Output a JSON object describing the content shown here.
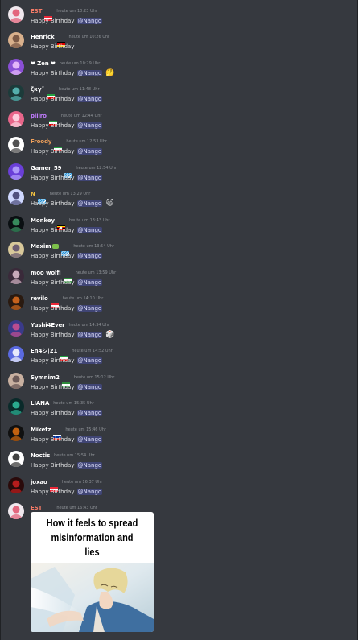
{
  "messages": [
    {
      "user": "EST",
      "name_color": "#f47b67",
      "flag": "austria",
      "time": "heute um 10:23 Uhr",
      "text": "Happy Birthday",
      "mention": "@Nango",
      "avatar": {
        "bg": "#f0e8ee",
        "fg": "#e0506a"
      }
    },
    {
      "user": "Henrick",
      "name_color": "#ffffff",
      "flag": "germany",
      "time": "heute um 10:26 Uhr",
      "text": "Happy Birthday",
      "mention": "",
      "avatar": {
        "bg": "#d9b08c",
        "fg": "#6b4a3a"
      }
    },
    {
      "user": "❤ Zen ❤",
      "name_color": "#ffffff",
      "flag": "",
      "time": "heute um 10:29 Uhr",
      "text": "Happy Birthday",
      "mention": "@Nango",
      "reaction": "🤔",
      "avatar": {
        "bg": "#8a4fd6",
        "fg": "#f2c7ff"
      }
    },
    {
      "user": "ζκγ˜",
      "name_color": "#ffffff",
      "flag": "iran",
      "time": "heute um 11:48 Uhr",
      "text": "Happy Birthday",
      "mention": "@Nango",
      "avatar": {
        "bg": "#1c3b3a",
        "fg": "#5ec3c0"
      }
    },
    {
      "user": "piiiro",
      "name_color": "#c27cff",
      "flag": "iran",
      "time": "heute um 12:44 Uhr",
      "text": "Happy Birthday",
      "mention": "@Nango",
      "avatar": {
        "bg": "#e8668a",
        "fg": "#ffe0ea"
      }
    },
    {
      "user": "Froody",
      "name_color": "#f0a05a",
      "flag": "iran",
      "time": "heute um 12:53 Uhr",
      "text": "Happy Birthday",
      "mention": "@Nango",
      "avatar": {
        "bg": "#ffffff",
        "fg": "#333333"
      }
    },
    {
      "user": "Gamer_59",
      "name_color": "#ffffff",
      "flag": "bavaria",
      "time": "heute um 12:54 Uhr",
      "text": "Happy Birthday",
      "mention": "@Nango",
      "avatar": {
        "bg": "#6a3fd8",
        "fg": "#b8a8ff"
      }
    },
    {
      "user": "N",
      "name_color": "#f0c040",
      "flag": "bavaria",
      "time": "heute um 13:29 Uhr",
      "text": "Happy Birthday",
      "mention": "@Nango",
      "reaction": "😸",
      "avatar": {
        "bg": "#cfd8ff",
        "fg": "#3a3a6a"
      }
    },
    {
      "user": "Monkey",
      "name_color": "#ffffff",
      "flag": "uganda",
      "time": "heute um 13:43 Uhr",
      "text": "Happy Birthday",
      "mention": "@Nango",
      "avatar": {
        "bg": "#0a0f12",
        "fg": "#3fa06a"
      }
    },
    {
      "user": "Maxim",
      "name_color": "#ffffff",
      "flag": "bavaria",
      "time": "heute um 13:54 Uhr",
      "text": "Happy Birthday",
      "mention": "@Nango",
      "avatar": {
        "bg": "#d8c89a",
        "fg": "#5a4a6a"
      }
    },
    {
      "user": "moo wolfi",
      "name_color": "#ffffff",
      "flag": "green",
      "time": "heute um 13:59 Uhr",
      "text": "Happy Birthday",
      "mention": "@Nango",
      "avatar": {
        "bg": "#3a2a3a",
        "fg": "#e0c0d0"
      }
    },
    {
      "user": "revilo",
      "name_color": "#ffffff",
      "flag": "austria",
      "time": "heute um 14:10 Uhr",
      "text": "Happy Birthday",
      "mention": "@Nango",
      "avatar": {
        "bg": "#2a1a10",
        "fg": "#e07020"
      }
    },
    {
      "user": "Yushi4Ever",
      "name_color": "#ffffff",
      "flag": "",
      "time": "heute um 14:34 Uhr",
      "text": "Happy Birthday",
      "mention": "@Nango",
      "reaction": "🎲",
      "avatar": {
        "bg": "#3a3a8a",
        "fg": "#d05090"
      }
    },
    {
      "user": "En4シ|21",
      "name_color": "#ffffff",
      "flag": "iran",
      "time": "heute um 14:52 Uhr",
      "text": "Happy Birthday",
      "mention": "@Nango",
      "avatar": {
        "bg": "#5a6ae0",
        "fg": "#ffffff"
      }
    },
    {
      "user": "Symnim2",
      "name_color": "#ffffff",
      "flag": "green",
      "time": "heute um 15:12 Uhr",
      "text": "Happy Birthday",
      "mention": "@Nango",
      "avatar": {
        "bg": "#c8b0a0",
        "fg": "#5a4a4a"
      }
    },
    {
      "user": "LIANA",
      "name_color": "#ffffff",
      "flag": "",
      "time": "heute um 15:35 Uhr",
      "text": "Happy Birthday",
      "mention": "@Nango",
      "avatar": {
        "bg": "#0a2a2a",
        "fg": "#30c0a0"
      }
    },
    {
      "user": "Miketz",
      "name_color": "#ffffff",
      "flag": "stripe",
      "time": "heute um 15:46 Uhr",
      "text": "Happy Birthday",
      "mention": "@Nango",
      "avatar": {
        "bg": "#101010",
        "fg": "#e07010"
      }
    },
    {
      "user": "Noctis",
      "name_color": "#ffffff",
      "flag": "",
      "time": "heute um 15:54 Uhr",
      "text": "Happy Birthday",
      "mention": "@Nango",
      "avatar": {
        "bg": "#ffffff",
        "fg": "#202020"
      }
    },
    {
      "user": "joxao",
      "name_color": "#ffffff",
      "flag": "austria",
      "time": "heute um 16:37 Uhr",
      "text": "Happy Birthday",
      "mention": "@Nango",
      "avatar": {
        "bg": "#2a0a0a",
        "fg": "#d02020"
      }
    },
    {
      "user": "EST",
      "name_color": "#f47b67",
      "flag": "austria",
      "time": "heute um 16:43 Uhr",
      "text": "",
      "mention": "",
      "avatar": {
        "bg": "#f0e8ee",
        "fg": "#e0506a"
      }
    }
  ],
  "attachment": {
    "caption": "How it feels to spread misinformation and lies",
    "caption_lines": [
      "How it feels to spread",
      "misinformation and",
      "lies"
    ]
  },
  "colors": {
    "background": "#36393f",
    "text": "#dcddde",
    "timestamp": "#8e9297",
    "mention_bg": "rgba(88,101,242,0.3)",
    "mention_text": "#dee0fc"
  }
}
